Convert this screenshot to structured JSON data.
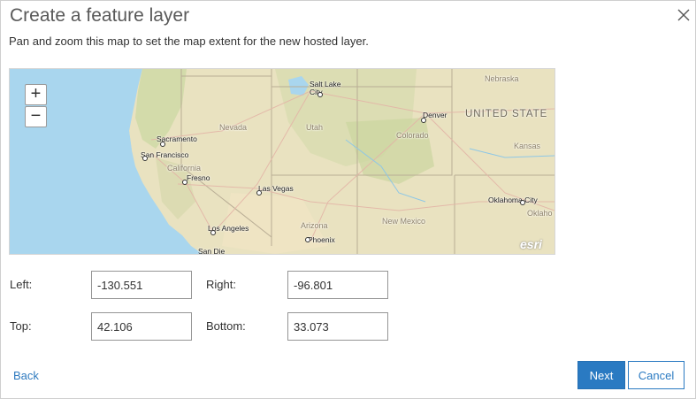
{
  "dialog": {
    "title": "Create a feature layer",
    "subtitle": "Pan and zoom this map to set the map extent for the new hosted layer.",
    "close_icon": "close-icon"
  },
  "map": {
    "zoom_in": "+",
    "zoom_out": "−",
    "attribution": "esri",
    "labels": {
      "nebraska": "Nebraska",
      "salt_lake_city": "Salt Lake\nCity",
      "denver": "Denver",
      "united_states": "UNITED STATE",
      "sacramento": "Sacramento",
      "nevada": "Nevada",
      "utah": "Utah",
      "colorado": "Colorado",
      "san_francisco": "San Francisco",
      "california": "California",
      "kansas": "Kansas",
      "fresno": "Fresno",
      "las_vegas": "Las Vegas",
      "oklahoma_city": "Oklahoma City",
      "oklahoma": "Oklaho",
      "new_mexico": "New Mexico",
      "arizona": "Arizona",
      "los_angeles": "Los Angeles",
      "phoenix": "Phoenix",
      "san_diego": "San Die"
    }
  },
  "extent": {
    "left_label": "Left:",
    "left_value": "-130.551",
    "right_label": "Right:",
    "right_value": "-96.801",
    "top_label": "Top:",
    "top_value": "42.106",
    "bottom_label": "Bottom:",
    "bottom_value": "33.073"
  },
  "footer": {
    "back_label": "Back",
    "next_label": "Next",
    "cancel_label": "Cancel"
  },
  "colors": {
    "accent": "#2a7ac2",
    "water": "#a9d6ee",
    "land": "#ece6c7"
  }
}
